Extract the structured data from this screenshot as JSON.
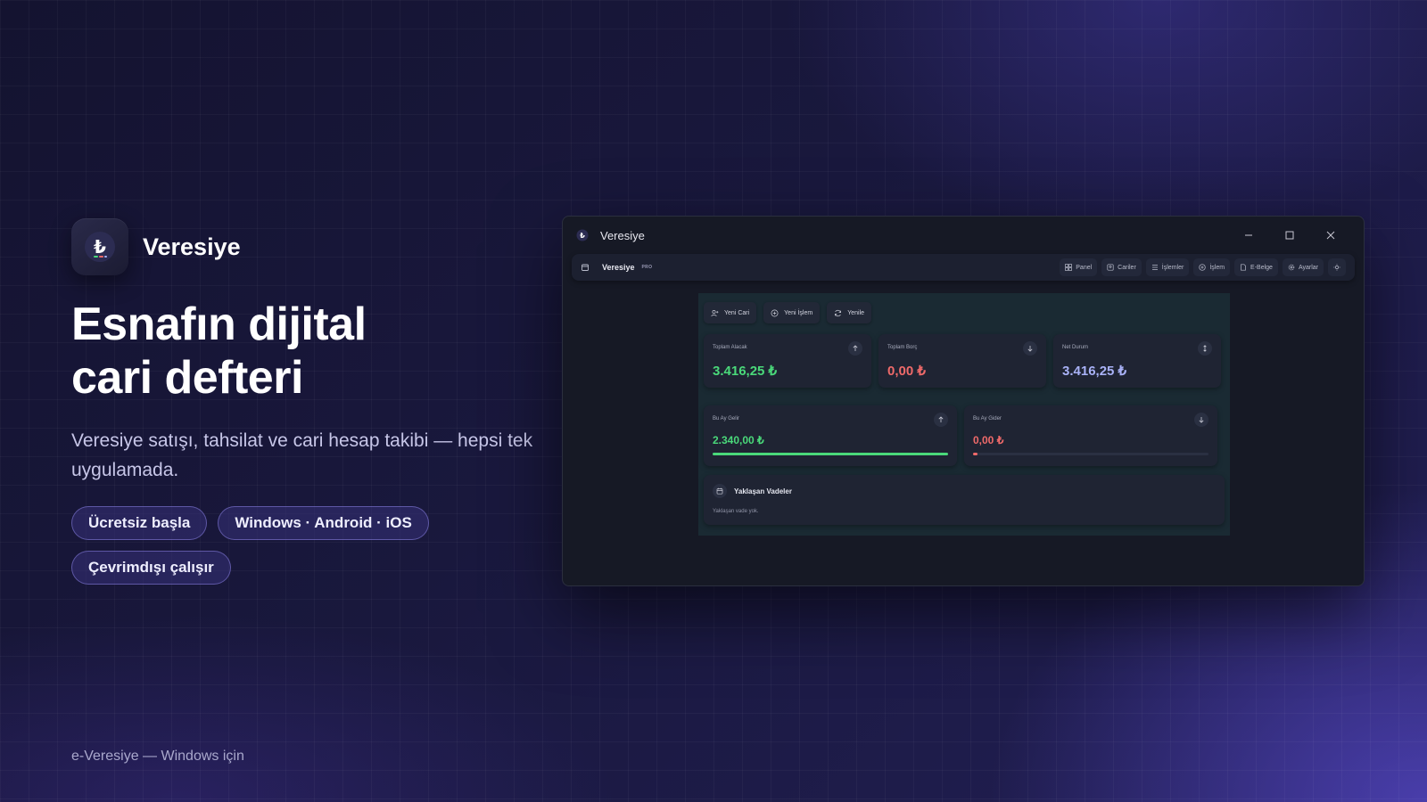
{
  "brand": {
    "name": "Veresiye",
    "logo_icon": "lira-icon"
  },
  "headline": {
    "line1": "Esnafın dijital",
    "line2": "cari defteri"
  },
  "subtitle": "Veresiye satışı, tahsilat ve cari hesap takibi — hepsi tek uygulamada.",
  "pills": [
    "Ücretsiz başla",
    "Windows · Android · iOS",
    "Çevrimdışı çalışır"
  ],
  "footer": "e-Veresiye — Windows için",
  "window": {
    "title": "Veresiye",
    "appbar": {
      "name": "Veresiye",
      "badge": "PRO",
      "nav": [
        "Panel",
        "Cariler",
        "İşlemler",
        "İşlem",
        "E-Belge",
        "Ayarlar"
      ]
    },
    "actions": [
      "Yeni Cari",
      "Yeni İşlem",
      "Yenile"
    ],
    "summary": [
      {
        "label": "Toplam Alacak",
        "value": "3.416,25 ₺",
        "icon": "arrow-up-icon"
      },
      {
        "label": "Toplam Borç",
        "value": "0,00 ₺",
        "icon": "arrow-down-icon"
      },
      {
        "label": "Net Durum",
        "value": "3.416,25 ₺",
        "icon": "arrows-updown-icon"
      }
    ],
    "monthly": [
      {
        "label": "Bu Ay Gelir",
        "value": "2.340,00 ₺",
        "progress": 1.0,
        "icon": "arrow-up-icon"
      },
      {
        "label": "Bu Ay Gider",
        "value": "0,00 ₺",
        "progress": 0.02,
        "icon": "arrow-down-icon"
      }
    ],
    "upcoming": {
      "title": "Yaklaşan Vadeler",
      "empty": "Yaklaşan vade yok."
    }
  },
  "colors": {
    "positive": "#4ad97a",
    "negative": "#ef6a6a",
    "neutral": "#a9b2f7",
    "accent": "#6c5ce7"
  }
}
